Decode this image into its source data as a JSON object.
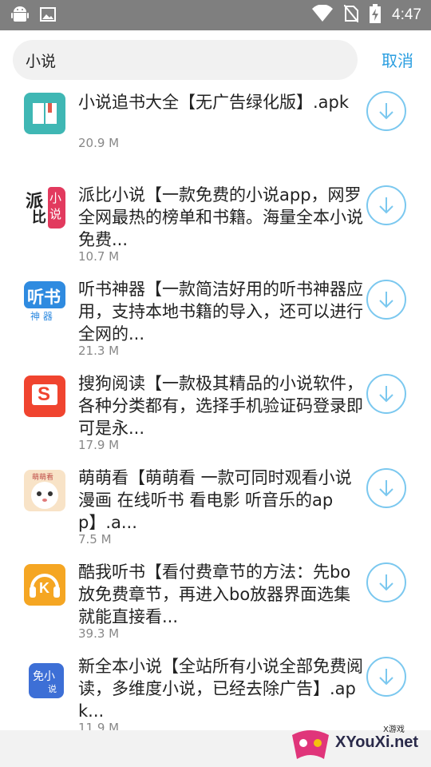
{
  "status_bar": {
    "time": "4:47"
  },
  "search": {
    "query": "小说",
    "cancel_label": "取消"
  },
  "results": [
    {
      "icon": "book-icon",
      "title": "小说追书大全【无广告绿化版】.apk",
      "size": "20.9 M"
    },
    {
      "icon": "paibi-icon",
      "title": "派比小说【一款免费的小说app，网罗全网最热的榜单和书籍。海量全本小说免费...",
      "size": "10.7 M",
      "icon_text_a": "派",
      "icon_text_b": "比",
      "icon_text_c": "小说"
    },
    {
      "icon": "tingshu-icon",
      "title": "听书神器【一款简洁好用的听书神器应用，支持本地书籍的导入，还可以进行全网的...",
      "size": "21.3 M",
      "icon_text_a": "听书",
      "icon_text_b": "神 器"
    },
    {
      "icon": "sogou-icon",
      "title": "搜狗阅读【一款极其精品的小说软件，各种分类都有，选择手机验证码登录即可是永...",
      "size": "17.9 M",
      "icon_text_a": "S"
    },
    {
      "icon": "mengmeng-icon",
      "title": "萌萌看【萌萌看 一款可同时观看小说 漫画 在线听书 看电影 听音乐的app】.a...",
      "size": "7.5 M",
      "icon_text_a": "萌萌看"
    },
    {
      "icon": "kuwo-icon",
      "title": "酷我听书【看付费章节的方法：先bo放免费章节，再进入bo放器界面选集就能直接看...",
      "size": "39.3 M",
      "icon_text_a": "K"
    },
    {
      "icon": "mianfei-icon",
      "title": "新全本小说【全站所有小说全部免费阅读，多维度小说，已经去除广告】.apk...",
      "size": "11.9 M",
      "icon_text_a": "免小",
      "icon_text_b": "说"
    }
  ],
  "watermark": {
    "brand": "XYouXi.net",
    "tag": "X游戏"
  },
  "colors": {
    "accent": "#2a9ee0",
    "download_ring": "#7bc8ef"
  }
}
